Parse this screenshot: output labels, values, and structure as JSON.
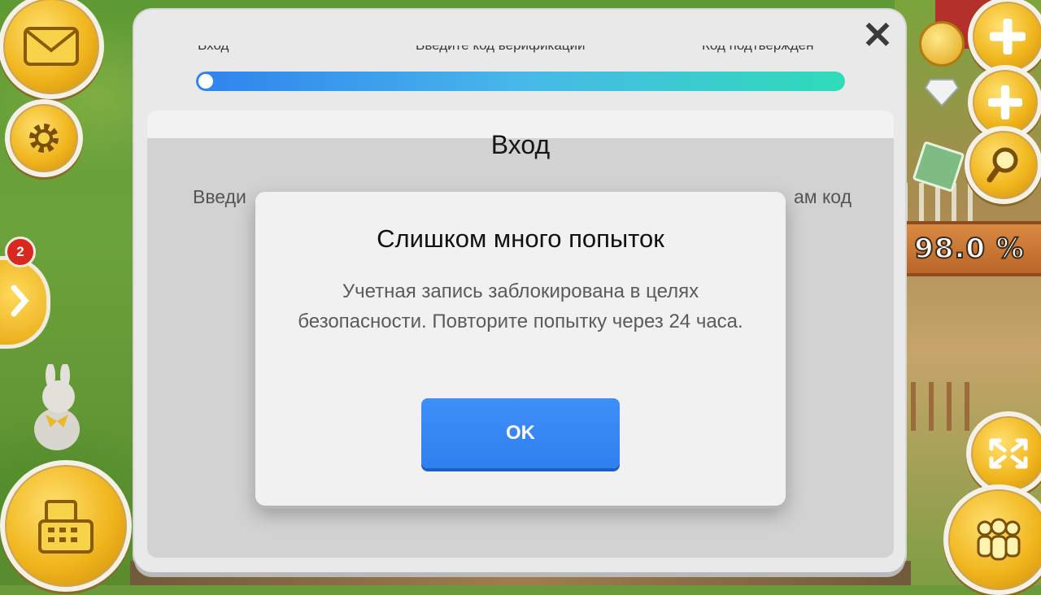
{
  "background": {
    "completion_percent": "98.0 %",
    "badge_count": "2"
  },
  "panel": {
    "close_glyph": "✕",
    "steps": [
      "Вход",
      "Введите код верификации",
      "Код подтвержден"
    ],
    "progress_fraction": 0.0,
    "title": "Вход",
    "desc_left": "Введи",
    "desc_right": "ам код"
  },
  "dialog": {
    "title": "Слишком много попыток",
    "message": "Учетная запись заблокирована в целях безопасности. Повторите попытку через 24 часа.",
    "ok_label": "OK"
  },
  "colors": {
    "accent": "#2f7fee",
    "progress_start": "#2f82ee",
    "progress_end": "#2fdcb8",
    "badge": "#d9281e"
  },
  "icons": [
    "mail-icon",
    "settings-icon",
    "arrow-right-icon",
    "cash-register-icon",
    "coin-icon",
    "plus-icon",
    "gem-icon",
    "magnifier-icon",
    "expand-icon",
    "friends-icon",
    "close-icon"
  ]
}
